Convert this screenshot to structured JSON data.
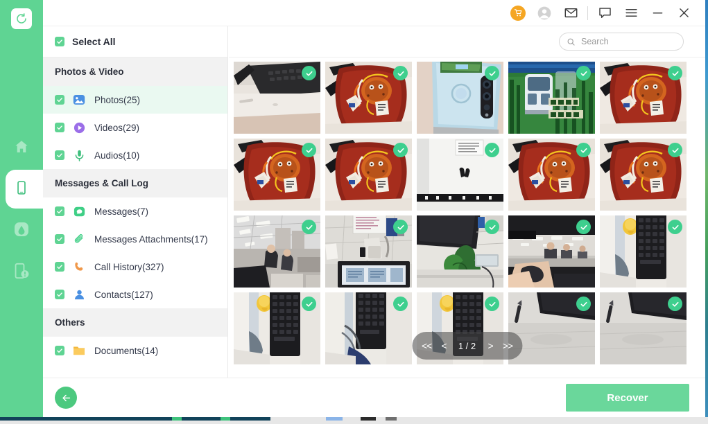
{
  "brand": {
    "logo_icon": "recovery-circular-arrow-icon",
    "accent_green": "#5fd493",
    "check_green": "#3ecf8e",
    "cart_orange": "#f5a623"
  },
  "rail": {
    "items": [
      {
        "name": "home",
        "icon": "home-icon",
        "active": false
      },
      {
        "name": "phone",
        "icon": "smartphone-icon",
        "active": true
      },
      {
        "name": "cloud",
        "icon": "cloud-droplet-icon",
        "active": false
      },
      {
        "name": "repair",
        "icon": "device-repair-icon",
        "active": false
      }
    ]
  },
  "titlebar": {
    "buttons": [
      {
        "name": "cart",
        "icon": "shopping-cart-icon"
      },
      {
        "name": "account",
        "icon": "user-account-icon"
      },
      {
        "name": "mail",
        "icon": "envelope-icon"
      },
      {
        "name": "feedback",
        "icon": "speech-bubble-icon"
      },
      {
        "name": "menu",
        "icon": "hamburger-menu-icon"
      },
      {
        "name": "minimize",
        "icon": "minimize-icon"
      },
      {
        "name": "close",
        "icon": "close-icon"
      }
    ]
  },
  "sidebar": {
    "select_all": {
      "label": "Select All",
      "checked": true
    },
    "groups": [
      {
        "title": "Photos & Video",
        "items": [
          {
            "label": "Photos(25)",
            "icon": "photo-icon",
            "checked": true,
            "selected": true
          },
          {
            "label": "Videos(29)",
            "icon": "video-play-icon",
            "checked": true,
            "selected": false
          },
          {
            "label": "Audios(10)",
            "icon": "microphone-icon",
            "checked": true,
            "selected": false
          }
        ]
      },
      {
        "title": "Messages & Call Log",
        "items": [
          {
            "label": "Messages(7)",
            "icon": "message-bubble-icon",
            "checked": true,
            "selected": false
          },
          {
            "label": "Messages Attachments(17)",
            "icon": "paperclip-icon",
            "checked": true,
            "selected": false
          },
          {
            "label": "Call History(327)",
            "icon": "phone-handset-icon",
            "checked": true,
            "selected": false
          },
          {
            "label": "Contacts(127)",
            "icon": "contact-person-icon",
            "checked": true,
            "selected": false
          }
        ]
      },
      {
        "title": "Others",
        "items": [
          {
            "label": "Documents(14)",
            "icon": "folder-icon",
            "checked": true,
            "selected": false
          }
        ]
      }
    ]
  },
  "search": {
    "placeholder": "Search",
    "value": "",
    "icon": "search-icon"
  },
  "gallery": {
    "thumbnails": [
      {
        "id": 1,
        "scene": "keyboard-on-white-desk",
        "checked": true
      },
      {
        "id": 2,
        "scene": "red-snack-package",
        "checked": true
      },
      {
        "id": 3,
        "scene": "blue-phone-back-camera",
        "checked": true
      },
      {
        "id": 4,
        "scene": "green-train-poster",
        "checked": true
      },
      {
        "id": 5,
        "scene": "red-snack-package",
        "checked": true
      },
      {
        "id": 6,
        "scene": "red-snack-package",
        "checked": true
      },
      {
        "id": 7,
        "scene": "red-snack-package",
        "checked": true
      },
      {
        "id": 8,
        "scene": "white-wall-sign",
        "checked": true
      },
      {
        "id": 9,
        "scene": "red-snack-package",
        "checked": true
      },
      {
        "id": 10,
        "scene": "red-snack-package",
        "checked": true
      },
      {
        "id": 11,
        "scene": "office-room-ceiling-lights",
        "checked": true
      },
      {
        "id": 12,
        "scene": "office-desk-monitor",
        "checked": true
      },
      {
        "id": 13,
        "scene": "monitor-with-plant",
        "checked": true
      },
      {
        "id": 14,
        "scene": "hand-on-mouse-office",
        "checked": true
      },
      {
        "id": 15,
        "scene": "keyboard-with-yellow-toy",
        "checked": true
      },
      {
        "id": 16,
        "scene": "keyboard-with-yellow-toy",
        "checked": true
      },
      {
        "id": 17,
        "scene": "keyboard-desk-cable",
        "checked": true
      },
      {
        "id": 18,
        "scene": "keyboard-with-yellow-toy",
        "checked": true
      },
      {
        "id": 19,
        "scene": "desk-pen-and-monitor",
        "checked": true
      },
      {
        "id": 20,
        "scene": "desk-pen-and-monitor",
        "checked": true
      }
    ],
    "pager": {
      "first_label": "<<",
      "prev_label": "<",
      "count_label": "1 / 2",
      "next_label": ">",
      "last_label": ">>",
      "current_page": 1,
      "total_pages": 2
    }
  },
  "footer": {
    "back_icon": "arrow-left-icon",
    "recover_label": "Recover"
  }
}
